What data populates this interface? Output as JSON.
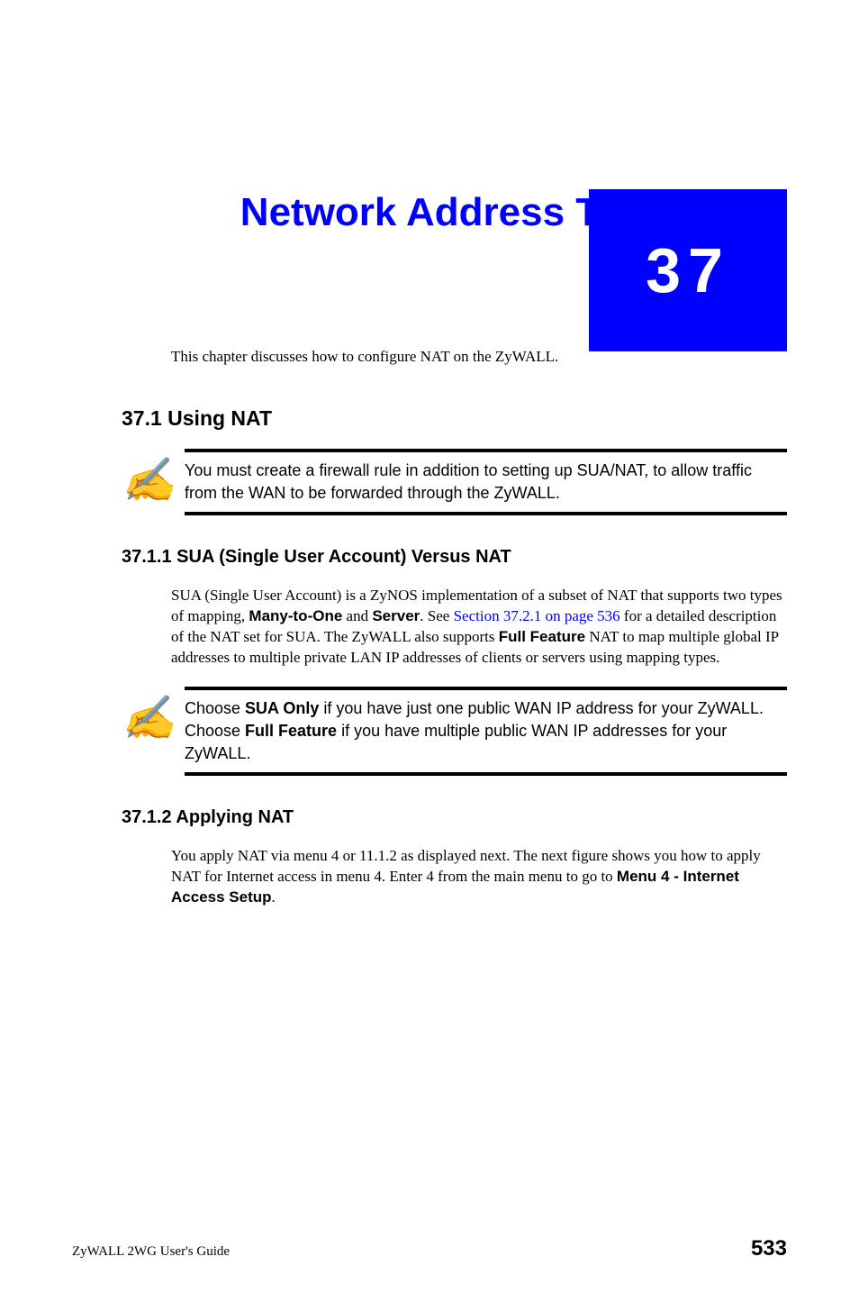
{
  "chapter": {
    "number": "37",
    "title": "Network Address Translation (NAT)"
  },
  "intro": "This chapter discusses how to configure NAT on the ZyWALL.",
  "section_37_1": {
    "heading": "37.1  Using NAT",
    "note": "You must create a firewall rule in addition to setting up SUA/NAT, to allow traffic from the WAN to be forwarded through the ZyWALL."
  },
  "section_37_1_1": {
    "heading": "37.1.1  SUA (Single User Account) Versus NAT",
    "para_part1": "SUA (Single User Account) is a ZyNOS implementation of a subset of NAT that supports two types of mapping, ",
    "bold_m2o": "Many-to-One",
    "mid1": " and ",
    "bold_server": "Server",
    "mid2": ". See ",
    "xref": "Section 37.2.1 on page 536",
    "mid3": " for a detailed description of the NAT set for SUA. The ZyWALL also supports ",
    "bold_ff": "Full Feature",
    "para_part2": " NAT to map multiple global IP addresses to multiple private LAN IP addresses of clients or servers using mapping types.",
    "note_line1a": "Choose ",
    "note_bold1": "SUA Only",
    "note_line1b": " if you have just one public WAN IP address for your ZyWALL.",
    "note_line2a": "Choose ",
    "note_bold2": "Full Feature",
    "note_line2b": " if you have multiple public WAN IP addresses for your ZyWALL."
  },
  "section_37_1_2": {
    "heading": "37.1.2  Applying NAT",
    "para_a": "You apply NAT via menu 4 or 11.1.2 as displayed next. The next figure shows you how to apply NAT for Internet access in menu 4. Enter 4 from the main menu to go to ",
    "bold_menu": "Menu 4 - Internet Access Setup",
    "para_b": "."
  },
  "footer": {
    "guide": "ZyWALL 2WG User's Guide",
    "page": "533"
  },
  "icons": {
    "note_glyph": "✍"
  }
}
